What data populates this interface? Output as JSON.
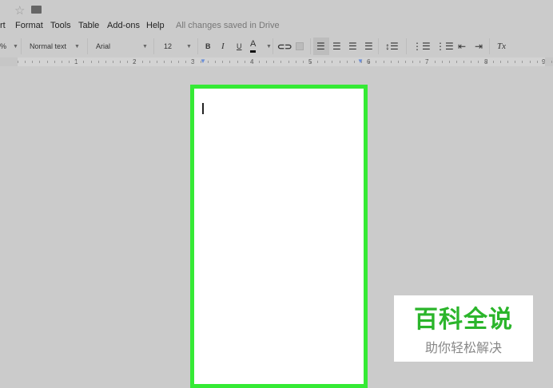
{
  "menu": {
    "items": [
      "rt",
      "Format",
      "Tools",
      "Table",
      "Add-ons",
      "Help"
    ],
    "status": "All changes saved in Drive"
  },
  "toolbar": {
    "zoom": "%",
    "style": "Normal text",
    "font": "Arial",
    "size": "12",
    "bold": "B",
    "italic": "I",
    "underline": "U",
    "text_color": "A",
    "clear_format": "Tx"
  },
  "ruler": {
    "numbers": [
      "1",
      "2",
      "3",
      "4",
      "5",
      "6",
      "7",
      "8",
      "9"
    ]
  },
  "watermark": {
    "title": "百科全说",
    "subtitle": "助你轻松解决"
  },
  "colors": {
    "page_border": "#35ea35",
    "watermark_green": "#2bb52b"
  }
}
